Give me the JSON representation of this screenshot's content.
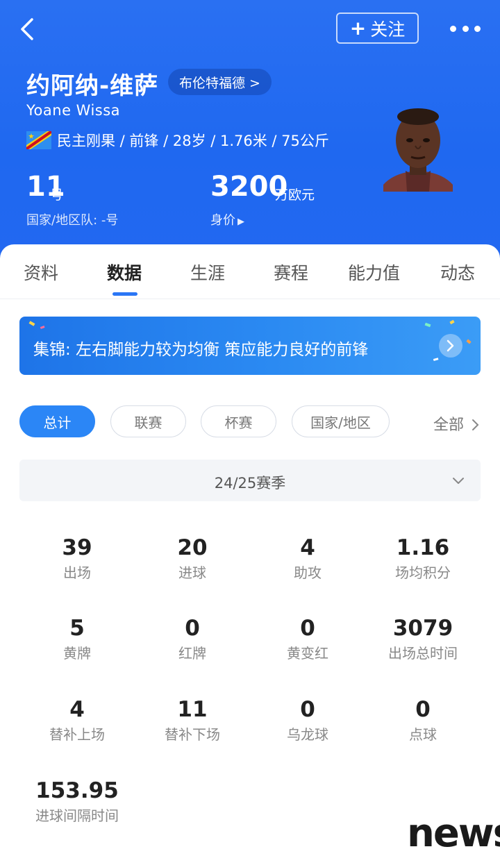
{
  "header": {
    "follow_label": "关注",
    "player_name_cn": "约阿纳-维萨",
    "team_label": "布伦特福德 >",
    "player_name_en": "Yoane Wissa",
    "info_line": "民主刚果 / 前锋 / 28岁 / 1.76米 / 75公斤",
    "shirt_number": "11",
    "shirt_unit": "号",
    "national_team_label": "国家/地区队: -号",
    "market_value": "3200",
    "market_value_unit": "万欧元",
    "market_value_label": "身价",
    "accent_color": "#2268f1"
  },
  "tabs": [
    {
      "label": "资料"
    },
    {
      "label": "数据",
      "active": true
    },
    {
      "label": "生涯"
    },
    {
      "label": "赛程"
    },
    {
      "label": "能力值"
    },
    {
      "label": "动态"
    }
  ],
  "banner": {
    "text": "集锦: 左右脚能力较为均衡 策应能力良好的前锋"
  },
  "filters": [
    {
      "label": "总计",
      "active": true
    },
    {
      "label": "联赛"
    },
    {
      "label": "杯赛"
    },
    {
      "label": "国家/地区"
    }
  ],
  "filter_all": "全部",
  "season": "24/25赛季",
  "stats": [
    {
      "value": "39",
      "label": "出场"
    },
    {
      "value": "20",
      "label": "进球"
    },
    {
      "value": "4",
      "label": "助攻"
    },
    {
      "value": "1.16",
      "label": "场均积分"
    },
    {
      "value": "5",
      "label": "黄牌"
    },
    {
      "value": "0",
      "label": "红牌"
    },
    {
      "value": "0",
      "label": "黄变红"
    },
    {
      "value": "3079",
      "label": "出场总时间"
    },
    {
      "value": "4",
      "label": "替补上场"
    },
    {
      "value": "11",
      "label": "替补下场"
    },
    {
      "value": "0",
      "label": "乌龙球"
    },
    {
      "value": "0",
      "label": "点球"
    },
    {
      "value": "153.95",
      "label": "进球间隔时间"
    }
  ],
  "watermark": "news"
}
